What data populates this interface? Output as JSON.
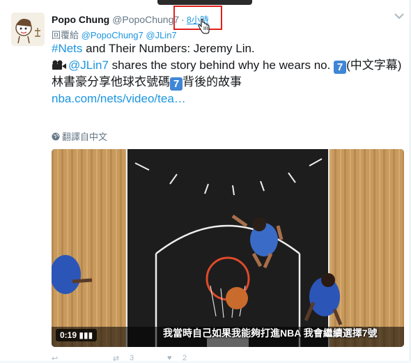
{
  "tweet": {
    "name": "Popo Chung",
    "handle": "@PopoChung7",
    "separator": "·",
    "time": "8小時",
    "reply_prefix": "回覆給",
    "reply_to_1": "@PopoChung7",
    "reply_to_2": "@JLin7",
    "hashtag": "#Nets",
    "line1_rest": " and Their Numbers: Jeremy Lin.",
    "mention": "@JLin7",
    "line2_rest": " shares the story behind why he wears no. ",
    "number_emoji": "7",
    "line2_end": "(中文字幕)",
    "chinese_before": "林書豪分享他球衣號碼",
    "chinese_after": "背後的故事",
    "link": "nba.com/nets/video/tea…",
    "translate": "翻譯自中文"
  },
  "video": {
    "duration": "0:19",
    "subtitle": "我當時自己如果我能夠打進NBA 我會繼續選擇7號"
  },
  "actions": {
    "retweets": "3",
    "likes": "2"
  },
  "colors": {
    "link": "#1b95e0",
    "text": "#14171a",
    "muted": "#657786",
    "highlight_box": "#e0201b"
  }
}
